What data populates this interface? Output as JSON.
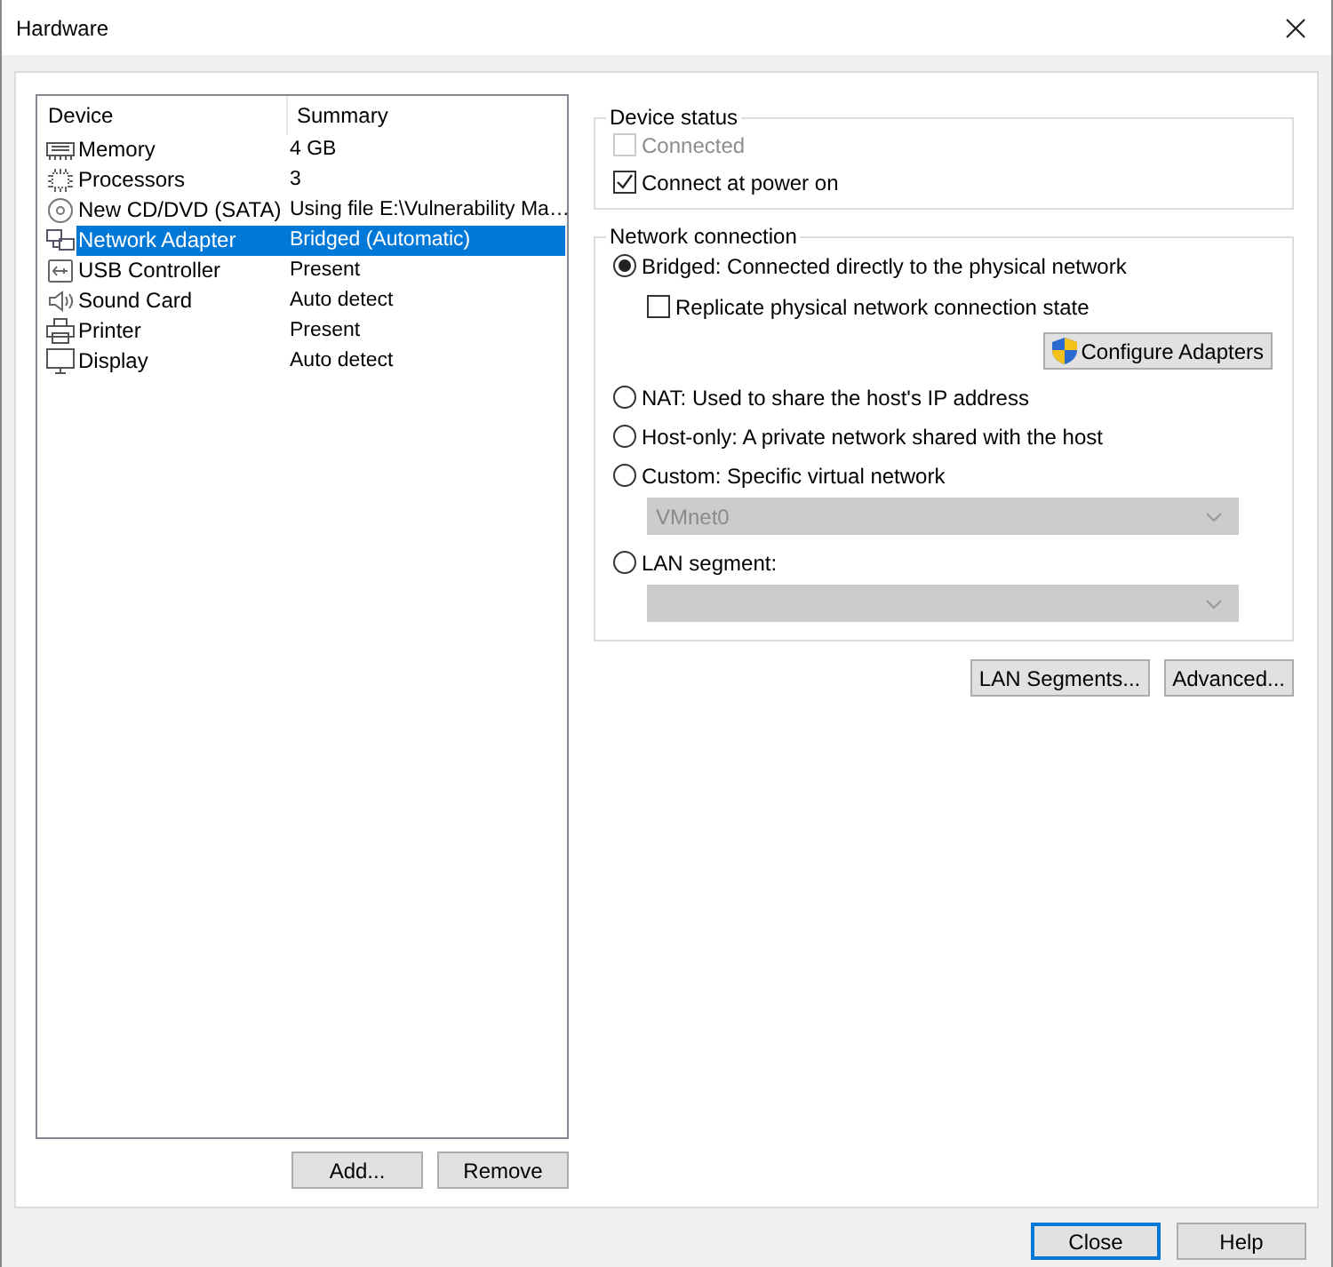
{
  "window": {
    "title": "Hardware"
  },
  "devices": {
    "columns": [
      "Device",
      "Summary"
    ],
    "rows": [
      {
        "kind": "memory",
        "name": "Memory",
        "summary": "4 GB",
        "selected": false
      },
      {
        "kind": "processor",
        "name": "Processors",
        "summary": "3",
        "selected": false
      },
      {
        "kind": "disc",
        "name": "New CD/DVD (SATA)",
        "summary": "Using file E:\\Vulnerability Ma…",
        "selected": false
      },
      {
        "kind": "network",
        "name": "Network Adapter",
        "summary": "Bridged (Automatic)",
        "selected": true
      },
      {
        "kind": "usb",
        "name": "USB Controller",
        "summary": "Present",
        "selected": false
      },
      {
        "kind": "sound",
        "name": "Sound Card",
        "summary": "Auto detect",
        "selected": false
      },
      {
        "kind": "printer",
        "name": "Printer",
        "summary": "Present",
        "selected": false
      },
      {
        "kind": "display",
        "name": "Display",
        "summary": "Auto detect",
        "selected": false
      }
    ],
    "buttons": [
      "Add...",
      "Remove"
    ]
  },
  "device_status": {
    "title": "Device status",
    "items": [
      {
        "label": "Connected",
        "checked": false,
        "disabled": true
      },
      {
        "label": "Connect at power on",
        "checked": true,
        "disabled": false
      }
    ]
  },
  "network_connection": {
    "title": "Network connection",
    "items": [
      {
        "kind": "radio",
        "label": "Bridged: Connected directly to the physical network",
        "selected": true
      },
      {
        "kind": "checkbox",
        "label": "Replicate physical network connection state",
        "checked": false
      },
      {
        "kind": "button",
        "label": "Configure Adapters"
      },
      {
        "kind": "radio",
        "label": "NAT: Used to share the host's IP address",
        "selected": false
      },
      {
        "kind": "radio",
        "label": "Host-only: A private network shared with the host",
        "selected": false
      },
      {
        "kind": "radio",
        "label": "Custom: Specific virtual network",
        "selected": false
      },
      {
        "kind": "dropdown",
        "value": "VMnet0",
        "disabled": true
      },
      {
        "kind": "radio",
        "label": "LAN segment:",
        "selected": false
      },
      {
        "kind": "dropdown",
        "value": "",
        "disabled": true
      }
    ]
  },
  "network_buttons": [
    "LAN Segments...",
    "Advanced..."
  ],
  "footer_buttons": [
    {
      "label": "Close",
      "default": true
    },
    {
      "label": "Help",
      "default": false
    }
  ]
}
